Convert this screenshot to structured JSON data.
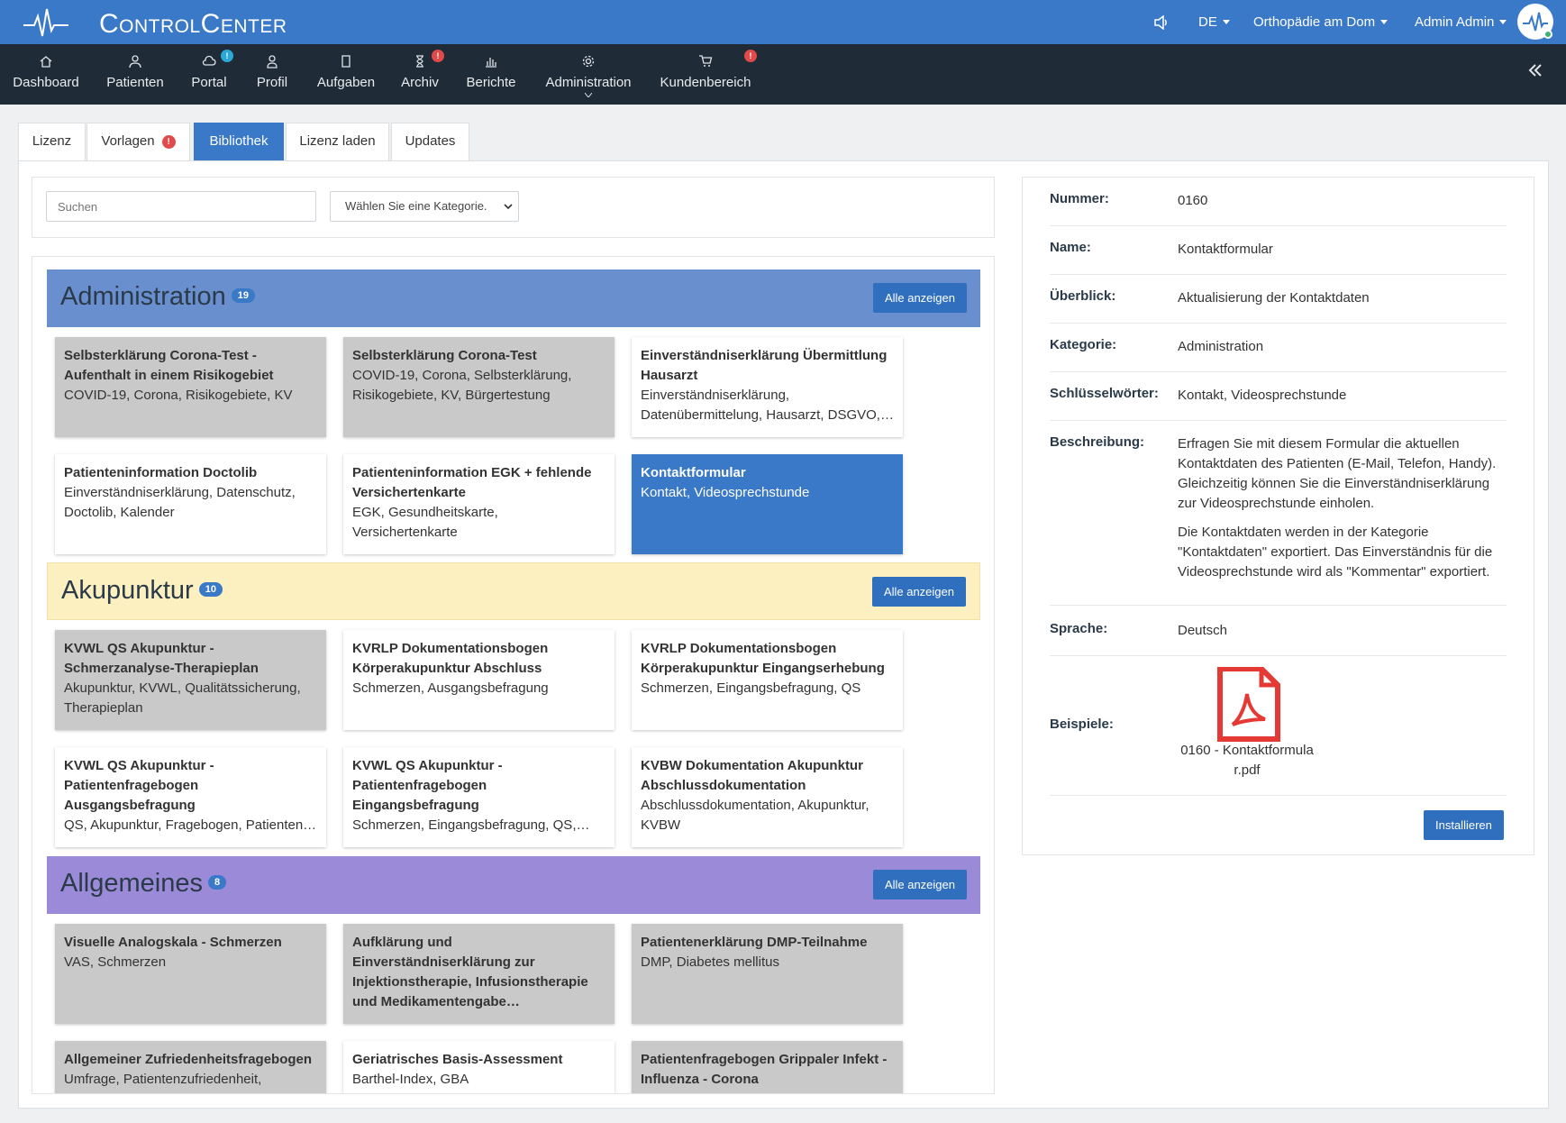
{
  "app": {
    "brand": "ControlCenter"
  },
  "topbar": {
    "lang": "DE",
    "clinic": "Orthopädie am Dom",
    "user": "Admin Admin"
  },
  "nav": [
    {
      "label": "Dashboard",
      "icon": "home-icon",
      "badge": ""
    },
    {
      "label": "Patienten",
      "icon": "patients-icon",
      "badge": ""
    },
    {
      "label": "Portal",
      "icon": "cloud-icon",
      "badge": "!"
    },
    {
      "label": "Profil",
      "icon": "user-icon",
      "badge": ""
    },
    {
      "label": "Aufgaben",
      "icon": "clipboard-icon",
      "badge": ""
    },
    {
      "label": "Archiv",
      "icon": "hourglass-icon",
      "badge": "!"
    },
    {
      "label": "Berichte",
      "icon": "chart-icon",
      "badge": ""
    },
    {
      "label": "Administration",
      "icon": "gear-icon",
      "badge": ""
    },
    {
      "label": "Kundenbereich",
      "icon": "cart-icon",
      "badge": "!"
    }
  ],
  "tabs": [
    {
      "label": "Lizenz"
    },
    {
      "label": "Vorlagen",
      "badge": "!"
    },
    {
      "label": "Bibliothek"
    },
    {
      "label": "Lizenz laden"
    },
    {
      "label": "Updates"
    }
  ],
  "filter": {
    "search_placeholder": "Suchen",
    "category_select": "Wählen Sie eine Kategorie."
  },
  "categories": [
    {
      "title": "Administration",
      "count": "19",
      "button": "Alle anzeigen",
      "color": "#6a8fcf",
      "cards": [
        {
          "title": "Selbsterklärung Corona-Test - Aufenthalt in einem Risikogebiet",
          "keywords": "COVID-19, Corona, Risikogebiete, KV"
        },
        {
          "title": "Selbsterklärung Corona-Test",
          "keywords": "COVID-19, Corona, Selbsterklärung, Risikogebiete, KV, Bürgertestung"
        },
        {
          "title": "Einverständniserklärung Übermittlung Hausarzt",
          "keywords": "Einverständniserklärung, Datenübermittelung, Hausarzt, DSGVO,…"
        },
        {
          "title": "Patienteninformation Doctolib",
          "keywords": "Einverständniserklärung, Datenschutz, Doctolib, Kalender"
        },
        {
          "title": "Patienteninformation EGK + fehlende Versichertenkarte",
          "keywords": "EGK, Gesundheitskarte, Versichertenkarte"
        },
        {
          "title": "Kontaktformular",
          "keywords": "Kontakt, Videosprechstunde"
        }
      ]
    },
    {
      "title": "Akupunktur",
      "count": "10",
      "button": "Alle anzeigen",
      "color": "#fdf0c0",
      "cards": [
        {
          "title": "KVWL QS Akupunktur - Schmerzanalyse-Therapieplan",
          "keywords": "Akupunktur, KVWL, Qualitätssicherung, Therapieplan"
        },
        {
          "title": "KVRLP Dokumentationsbogen Körperakupunktur Abschluss",
          "keywords": "Schmerzen, Ausgangsbefragung"
        },
        {
          "title": "KVRLP Dokumentationsbogen Körperakupunktur Eingangserhebung",
          "keywords": "Schmerzen, Eingangsbefragung, QS"
        },
        {
          "title": "KVWL QS Akupunktur - Patientenfragebogen Ausgangsbefragung",
          "keywords": "QS, Akupunktur, Fragebogen, Patienten…"
        },
        {
          "title": "KVWL QS Akupunktur - Patientenfragebogen Eingangsbefragung",
          "keywords": "Schmerzen, Eingangsbefragung, QS,…"
        },
        {
          "title": "KVBW Dokumentation Akupunktur Abschlussdokumentation",
          "keywords": "Abschlussdokumentation, Akupunktur, KVBW"
        }
      ]
    },
    {
      "title": "Allgemeines",
      "count": "8",
      "button": "Alle anzeigen",
      "color": "#9a8ad8",
      "cards": [
        {
          "title": "Visuelle Analogskala - Schmerzen",
          "keywords": "VAS, Schmerzen"
        },
        {
          "title": "Aufklärung und Einverständniserklärung zur Injektionstherapie, Infusionstherapie und Medikamentengabe…",
          "keywords": ""
        },
        {
          "title": "Patientenerklärung DMP-Teilnahme",
          "keywords": "DMP, Diabetes mellitus"
        },
        {
          "title": "Allgemeiner Zufriedenheitsfragebogen",
          "keywords": "Umfrage, Patientenzufriedenheit,"
        },
        {
          "title": "Geriatrisches Basis-Assessment",
          "keywords": "Barthel-Index, GBA"
        },
        {
          "title": "Patientenfragebogen Grippaler Infekt - Influenza - Corona",
          "keywords": ""
        }
      ]
    }
  ],
  "detail": {
    "number_label": "Nummer:",
    "number": "0160",
    "name_label": "Name:",
    "name": "Kontaktformular",
    "overview_label": "Überblick:",
    "overview": "Aktualisierung der Kontaktdaten",
    "category_label": "Kategorie:",
    "category": "Administration",
    "keywords_label": "Schlüsselwörter:",
    "keywords": "Kontakt, Videosprechstunde",
    "description_label": "Beschreibung:",
    "description_p1": "Erfragen Sie mit diesem Formular die aktuellen Kontaktdaten des Patienten (E-Mail, Telefon, Handy). Gleichzeitig können Sie die Einverständniserklärung zur Videosprechstunde einholen.",
    "description_p2": "Die Kontaktdaten werden in der Kategorie \"Kontaktdaten\" exportiert. Das Einverständnis für die Videosprechstunde wird als \"Kommentar\" exportiert.",
    "language_label": "Sprache:",
    "language": "Deutsch",
    "examples_label": "Beispiele:",
    "example_file_l1": "0160 - Kontaktformula",
    "example_file_l2": "r.pdf",
    "install_button": "Installieren"
  }
}
